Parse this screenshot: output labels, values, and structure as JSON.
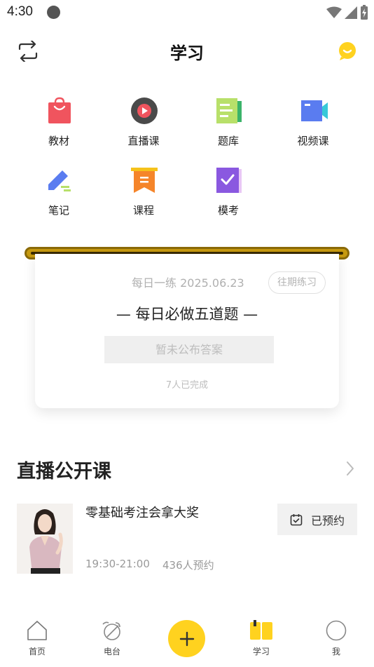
{
  "status_bar": {
    "time": "4:30"
  },
  "header": {
    "title": "学习"
  },
  "grid": [
    {
      "label": "教材",
      "icon": "textbook-bag-icon"
    },
    {
      "label": "直播课",
      "icon": "live-play-icon"
    },
    {
      "label": "题库",
      "icon": "question-bank-icon"
    },
    {
      "label": "视频课",
      "icon": "video-camera-icon"
    },
    {
      "label": "笔记",
      "icon": "pencil-note-icon"
    },
    {
      "label": "课程",
      "icon": "course-bookmark-icon"
    },
    {
      "label": "模考",
      "icon": "mock-exam-icon"
    }
  ],
  "daily": {
    "date": "每日一练 2025.06.23",
    "history_label": "往期练习",
    "title": "— 每日必做五道题 —",
    "answer_label": "暂未公布答案",
    "completed": "7人已完成"
  },
  "live": {
    "section_title": "直播公开课",
    "course": {
      "name": "零基础考注会拿大奖",
      "time": "19:30-21:00",
      "count": "436人预约",
      "reserve_label": "已预约"
    }
  },
  "nav": {
    "home": "首页",
    "radio": "电台",
    "study": "学习",
    "me": "我"
  },
  "colors": {
    "accent": "#ffd21f",
    "scroll_gold": "#c79a10"
  }
}
